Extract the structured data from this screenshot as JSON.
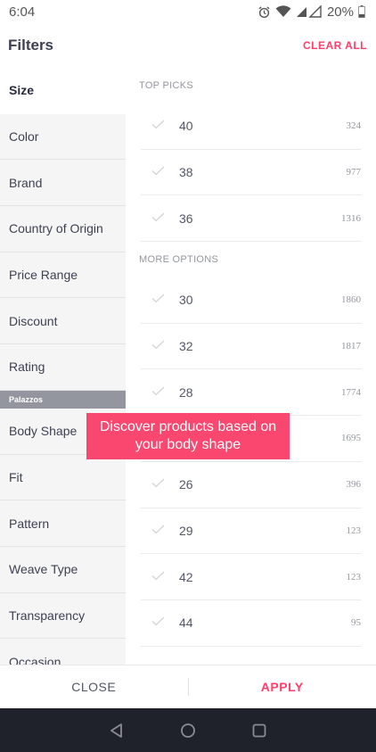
{
  "status": {
    "time": "6:04",
    "battery": "20%"
  },
  "header": {
    "title": "Filters",
    "clear_all": "CLEAR ALL"
  },
  "sidebar": {
    "items_top": [
      {
        "label": "Size",
        "active": true
      },
      {
        "label": "Color"
      },
      {
        "label": "Brand"
      },
      {
        "label": "Country of Origin"
      },
      {
        "label": "Price Range"
      },
      {
        "label": "Discount"
      },
      {
        "label": "Rating"
      }
    ],
    "group_label": "Palazzos",
    "items_group": [
      {
        "label": "Body Shape"
      },
      {
        "label": "Fit"
      },
      {
        "label": "Pattern"
      },
      {
        "label": "Weave Type"
      },
      {
        "label": "Transparency"
      },
      {
        "label": "Occasion"
      }
    ]
  },
  "content": {
    "top_picks_title": "TOP PICKS",
    "top_picks": [
      {
        "value": "40",
        "count": "324"
      },
      {
        "value": "38",
        "count": "977"
      },
      {
        "value": "36",
        "count": "1316"
      }
    ],
    "more_options_title": "MORE OPTIONS",
    "more_options": [
      {
        "value": "30",
        "count": "1860"
      },
      {
        "value": "32",
        "count": "1817"
      },
      {
        "value": "28",
        "count": "1774"
      },
      {
        "value": "",
        "count": "1695"
      },
      {
        "value": "26",
        "count": "396"
      },
      {
        "value": "29",
        "count": "123"
      },
      {
        "value": "42",
        "count": "123"
      },
      {
        "value": "44",
        "count": "95"
      }
    ]
  },
  "tooltip": {
    "text": "Discover products based on your body shape"
  },
  "footer": {
    "close": "CLOSE",
    "apply": "APPLY"
  },
  "colors": {
    "accent": "#ff3f6c",
    "tooltip": "#f94770",
    "sidebar_bg": "#f5f5f6",
    "navbar": "#1f222a"
  },
  "icons": [
    "alarm-icon",
    "wifi-icon",
    "signal-icon",
    "battery-icon",
    "check-icon",
    "back-nav-icon",
    "home-nav-icon",
    "recents-nav-icon"
  ]
}
